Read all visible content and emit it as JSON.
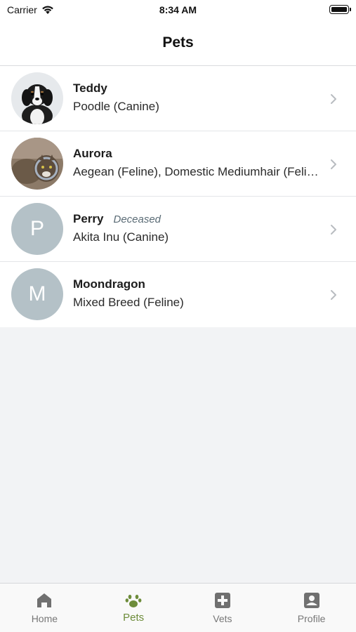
{
  "status_bar": {
    "carrier": "Carrier",
    "time": "8:34 AM"
  },
  "header": {
    "title": "Pets"
  },
  "pets": [
    {
      "name": "Teddy",
      "status": "",
      "breed": "Poodle (Canine)",
      "avatar": "photo-dog"
    },
    {
      "name": "Aurora",
      "status": "",
      "breed": "Aegean (Feline), Domestic Mediumhair (Feline)",
      "avatar": "photo-cat"
    },
    {
      "name": "Perry",
      "status": "Deceased",
      "breed": "Akita Inu (Canine)",
      "avatar_letter": "P"
    },
    {
      "name": "Moondragon",
      "status": "",
      "breed": "Mixed Breed (Feline)",
      "avatar_letter": "M"
    }
  ],
  "tab_bar": {
    "active": "Pets",
    "tabs": [
      {
        "label": "Home",
        "icon": "home-icon"
      },
      {
        "label": "Pets",
        "icon": "paw-icon"
      },
      {
        "label": "Vets",
        "icon": "medical-cross-icon"
      },
      {
        "label": "Profile",
        "icon": "profile-icon"
      }
    ]
  },
  "colors": {
    "accent": "#6d8c3a",
    "avatar_placeholder": "#b4c1c7",
    "background": "#f2f3f5"
  }
}
